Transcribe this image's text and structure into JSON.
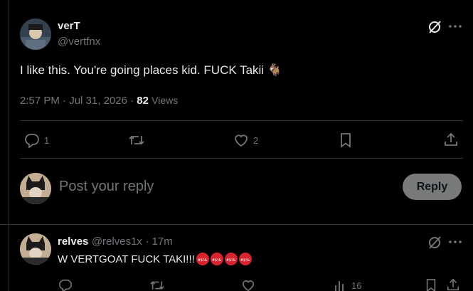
{
  "tweet": {
    "author_name": "verT",
    "author_handle": "@vertfnx",
    "text": "I like this. You're going places kid. FUCK Takii",
    "emoji": "🐐",
    "time": "2:57 PM",
    "date": "Jul 31, 2026",
    "views_count": "82",
    "views_label": "Views",
    "reply_count": "1",
    "like_count": "2"
  },
  "composer": {
    "placeholder": "Post your reply",
    "reply_label": "Reply"
  },
  "reply": {
    "author_name": "relves",
    "author_handle": "@relves1x",
    "age": "17m",
    "text": "W VERTGOAT FUCK TAKI!!!",
    "views_count": "16"
  },
  "colors": {
    "background": "#000000",
    "text_primary": "#e7e9ea",
    "text_secondary": "#71767b",
    "divider": "#2f3336",
    "reply_button_bg": "#787a7a"
  },
  "icons": {
    "grok": "grok-icon",
    "more": "more-icon",
    "reply": "reply-icon",
    "repost": "repost-icon",
    "like": "like-icon",
    "bookmark": "bookmark-icon",
    "share": "share-icon",
    "views": "views-icon"
  }
}
